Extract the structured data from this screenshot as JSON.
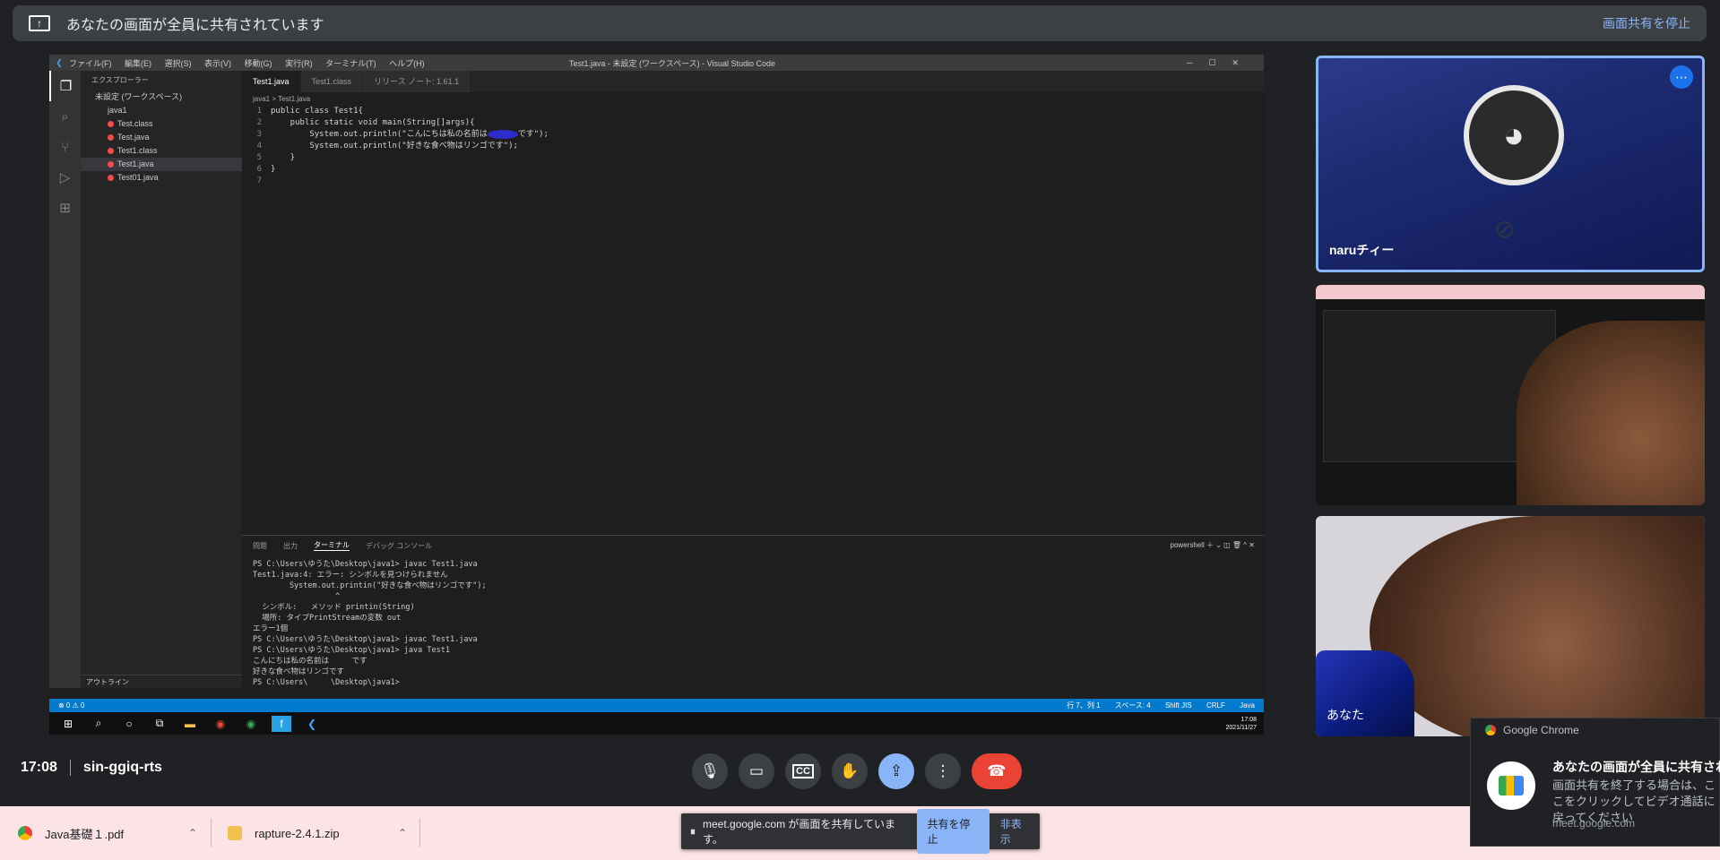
{
  "banner": {
    "text": "あなたの画面が全員に共有されています",
    "stop_label": "画面共有を停止"
  },
  "vscode": {
    "menu": [
      "ファイル(F)",
      "編集(E)",
      "選択(S)",
      "表示(V)",
      "移動(G)",
      "実行(R)",
      "ターミナル(T)",
      "ヘルプ(H)"
    ],
    "window_title": "Test1.java - 未設定 (ワークスペース) - Visual Studio Code",
    "explorer_title": "エクスプローラー",
    "workspace": "未設定 (ワークスペース)",
    "folder": "java1",
    "files": [
      "Test.class",
      "Test.java",
      "Test1.class",
      "Test1.java",
      "Test01.java"
    ],
    "outline": "アウトライン",
    "tabs": [
      "Test1.java",
      "Test1.class",
      "リリース ノート: 1.61.1"
    ],
    "breadcrumb": "java1 > Test1.java",
    "code": {
      "l1": "public class Test1{",
      "l2": "    public static void main(String[]args){",
      "l3a": "        System.out.println(\"こんにちは私の名前は",
      "l3b": "です\");",
      "l4": "        System.out.println(\"好きな食べ物はリンゴです\");",
      "l5": "    }",
      "l6": "}",
      "l7": ""
    },
    "panel_tabs": [
      "問題",
      "出力",
      "ターミナル",
      "デバッグ コンソール"
    ],
    "panel_shell": "powershell",
    "terminal": [
      "PS C:\\Users\\ゆうた\\Desktop\\java1> javac Test1.java",
      "Test1.java:4: エラー: シンボルを見つけられません",
      "        System.out.printin(\"好きな食べ物はリンゴです\");",
      "                  ^",
      "  シンボル:   メソッド printin(String)",
      "  場所: タイプPrintStreamの変数 out",
      "エラー1個",
      "PS C:\\Users\\ゆうた\\Desktop\\java1> javac Test1.java",
      "PS C:\\Users\\ゆうた\\Desktop\\java1> java Test1",
      "こんにちは私の名前は     です",
      "好きな食べ物はリンゴです",
      "PS C:\\Users\\     \\Desktop\\java1> "
    ],
    "status_left": "⊗ 0 ⚠ 0",
    "status_right": [
      "行 7、列 1",
      "スペース: 4",
      "Shift JIS",
      "CRLF",
      "Java"
    ],
    "clock_time": "17:08",
    "clock_date": "2021/11/27"
  },
  "tiles": {
    "naru": {
      "name": "naruチィー"
    },
    "you": {
      "name": "あなた"
    }
  },
  "meet": {
    "time": "17:08",
    "code": "sin-ggiq-rts"
  },
  "downloads": [
    {
      "name": "Java基礎１.pdf"
    },
    {
      "name": "rapture-2.4.1.zip"
    }
  ],
  "share_pill": {
    "text": "meet.google.com が画面を共有しています。",
    "stop": "共有を停止",
    "hide": "非表示"
  },
  "notification": {
    "app": "Google Chrome",
    "title": "あなたの画面が全員に共有されています",
    "body": "画面共有を終了する場合は、ここをクリックしてビデオ通話に戻ってください",
    "source": "meet.google.com"
  }
}
